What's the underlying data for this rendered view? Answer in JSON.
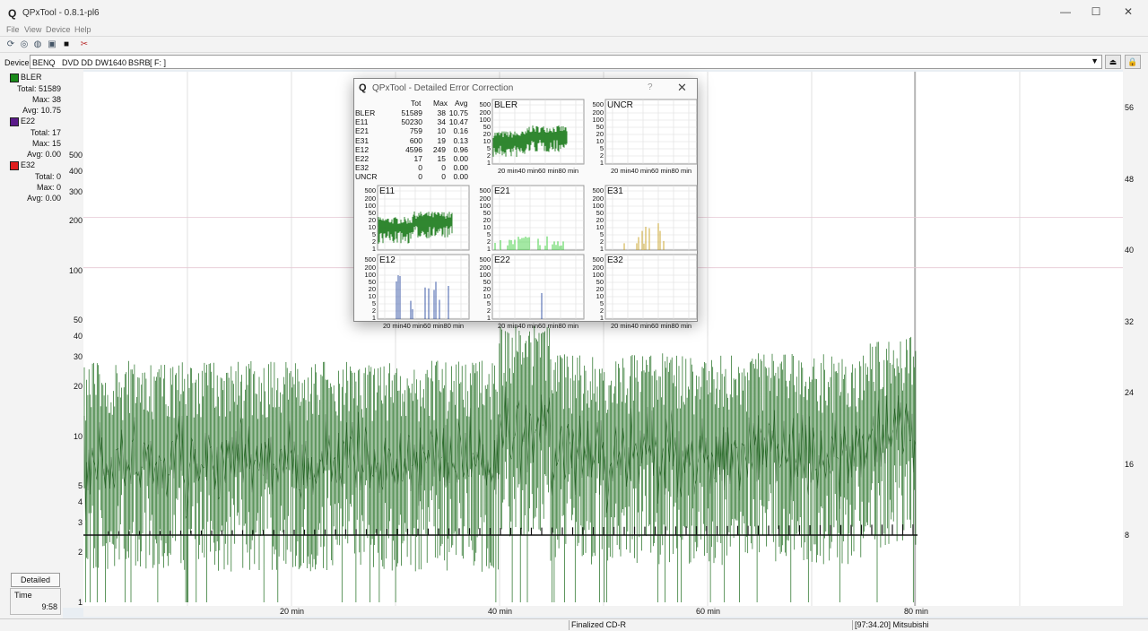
{
  "window": {
    "title": "QPxTool - 0.8.1-pl6",
    "app_icon": "Q",
    "minimize": "—",
    "maximize": "☐",
    "close": "✕"
  },
  "menu": [
    "File",
    "View",
    "Device",
    "Help"
  ],
  "device": {
    "label": "Device:",
    "vendor": "BENQ",
    "model": "DVD DD DW1640",
    "fw": "BSRB",
    "drive": "[ F: ]"
  },
  "legend": [
    {
      "name": "BLER",
      "color": "#1a8a1a",
      "total": "Total: 51589",
      "max": "Max: 38",
      "avg": "Avg: 10.75"
    },
    {
      "name": "E22",
      "color": "#5a1a8a",
      "total": "Total: 17",
      "max": "Max: 15",
      "avg": "Avg: 0.00"
    },
    {
      "name": "E32",
      "color": "#e02020",
      "total": "Total: 0",
      "max": "Max: 0",
      "avg": "Avg: 0.00"
    }
  ],
  "buttons": {
    "detailed": "Detailed"
  },
  "time": {
    "label": "Time",
    "value": "9:58"
  },
  "status": {
    "disc": "Finalized CD-R",
    "info": "[97:34.20] Mitsubishi"
  },
  "dialog": {
    "title": "QPxTool - Detailed Error Correction",
    "help": "?",
    "close": "✕",
    "headers": [
      "Tot",
      "Max",
      "Avg"
    ],
    "rows": [
      {
        "name": "BLER",
        "tot": "51589",
        "max": "38",
        "avg": "10.75"
      },
      {
        "name": "E11",
        "tot": "50230",
        "max": "34",
        "avg": "10.47"
      },
      {
        "name": "E21",
        "tot": "759",
        "max": "10",
        "avg": "0.16"
      },
      {
        "name": "E31",
        "tot": "600",
        "max": "19",
        "avg": "0.13"
      },
      {
        "name": "E12",
        "tot": "4596",
        "max": "249",
        "avg": "0.96"
      },
      {
        "name": "E22",
        "tot": "17",
        "max": "15",
        "avg": "0.00"
      },
      {
        "name": "E32",
        "tot": "0",
        "max": "0",
        "avg": "0.00"
      },
      {
        "name": "UNCR",
        "tot": "0",
        "max": "0",
        "avg": "0.00"
      }
    ],
    "mini_labels": [
      "500",
      "200",
      "100",
      "50",
      "20",
      "10",
      "5",
      "2",
      "1"
    ],
    "mini_x": "20 min40 min60 min80 min",
    "charts": [
      {
        "name": "BLER",
        "color": "#1a7a1a",
        "kind": "dense"
      },
      {
        "name": "UNCR",
        "color": "#1a7a1a",
        "kind": "none"
      },
      {
        "name": "E11",
        "color": "#1a7a1a",
        "kind": "dense"
      },
      {
        "name": "E21",
        "color": "#33cc33",
        "kind": "low"
      },
      {
        "name": "E31",
        "color": "#c8a020",
        "kind": "spikes"
      },
      {
        "name": "E12",
        "color": "#2a4aa0",
        "kind": "tall"
      },
      {
        "name": "E22",
        "color": "#2a4aa0",
        "kind": "single"
      },
      {
        "name": "E32",
        "color": "#2a4aa0",
        "kind": "none"
      }
    ]
  },
  "chart_data": {
    "type": "line",
    "series": [
      {
        "name": "BLER",
        "color": "#1a6a1a",
        "max": 38,
        "avg": 10.75
      },
      {
        "name": "E22",
        "color": "#5a1a8a",
        "max": 15,
        "avg": 0.0
      },
      {
        "name": "E32",
        "color": "#e02020",
        "max": 0,
        "avg": 0.0
      }
    ],
    "x_ticks": [
      "20 min",
      "40 min",
      "60 min",
      "80 min"
    ],
    "y_ticks": [
      "500",
      "400",
      "300",
      "200",
      "100",
      "50",
      "40",
      "30",
      "20",
      "10",
      "5",
      "4",
      "3",
      "2",
      "1"
    ],
    "y_right_ticks": [
      "56",
      "48",
      "40",
      "32",
      "24",
      "16",
      "8"
    ],
    "y_scale": "log",
    "ylim": [
      1,
      1000
    ],
    "grid": true
  }
}
